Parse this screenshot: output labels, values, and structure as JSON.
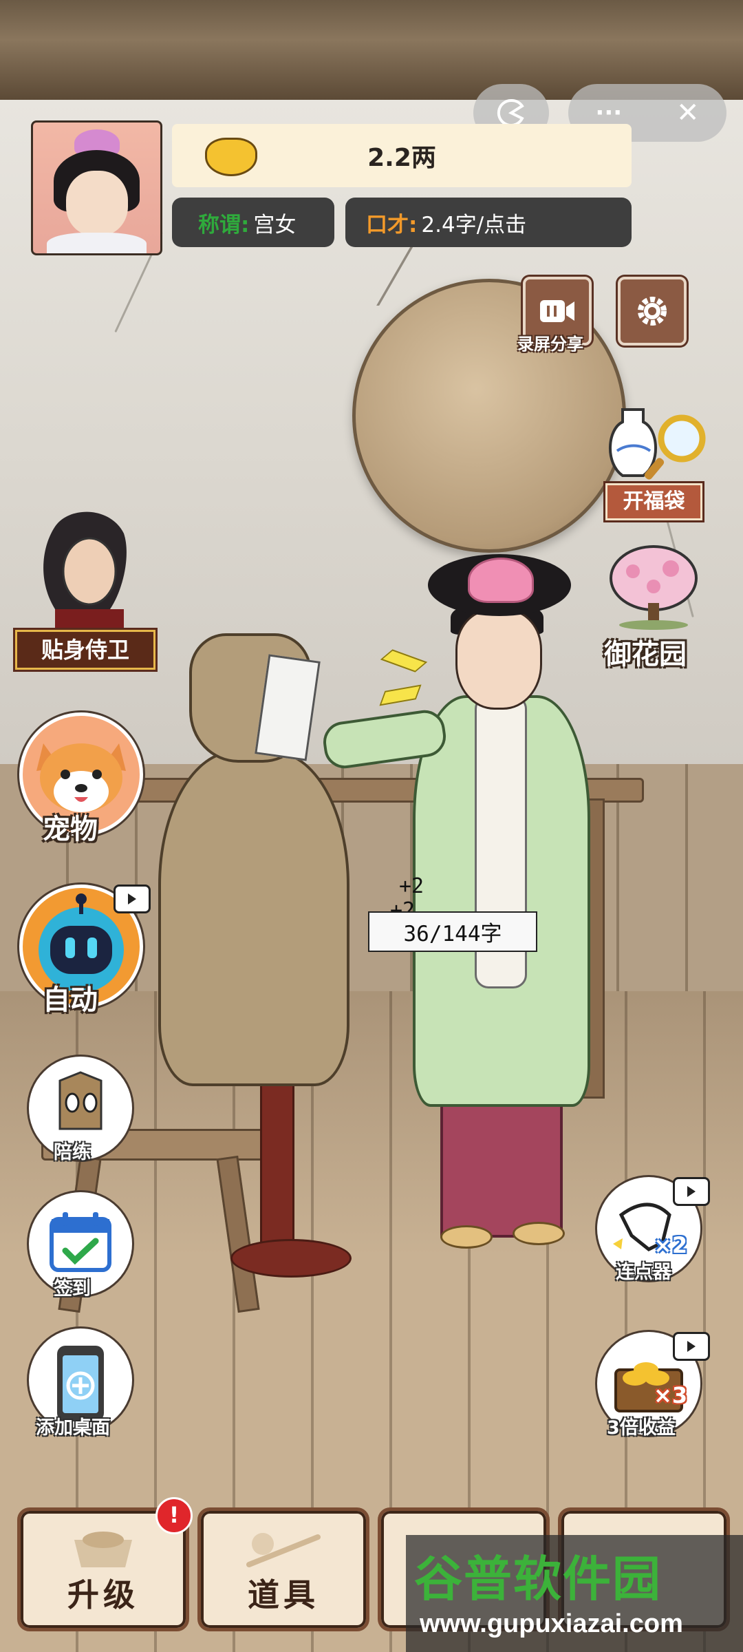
{
  "hud": {
    "money": "2.2两",
    "title_key": "称谓:",
    "title_value": "宫女",
    "eloquence_key": "口才:",
    "eloquence_value": "2.4字/点击"
  },
  "top_bar": {
    "more_glyph": "···",
    "close_glyph": "✕"
  },
  "tools": {
    "record_share_label": "录屏分享",
    "bag_label": "开福袋",
    "garden_label": "御花园"
  },
  "side": {
    "guard_label": "贴身侍卫",
    "pet_label": "宠物",
    "auto_label": "自动",
    "sparring_label": "陪练",
    "checkin_label": "签到",
    "add_desktop_label": "添加桌面"
  },
  "right": {
    "clicker_label": "连点器",
    "clicker_badge": "×2",
    "triple_label": "3倍收益",
    "triple_badge": "×3"
  },
  "progress": {
    "text": "36/144字",
    "float_1": "+2",
    "float_2": "+2",
    "current": 36,
    "total": 144
  },
  "bottom_nav": {
    "upgrade_label": "升级",
    "items_label": "道具",
    "upgrade_badge": "!"
  },
  "watermark": {
    "title": "谷普软件园",
    "url": "www.gupuxiazai.com"
  },
  "colors": {
    "hud_pill": "#3e3e3e",
    "title_key_color": "#2faa3c",
    "eloquence_key_color": "#f39a2a",
    "money_bar": "#fbf1d9",
    "notif_red": "#e0262b"
  }
}
